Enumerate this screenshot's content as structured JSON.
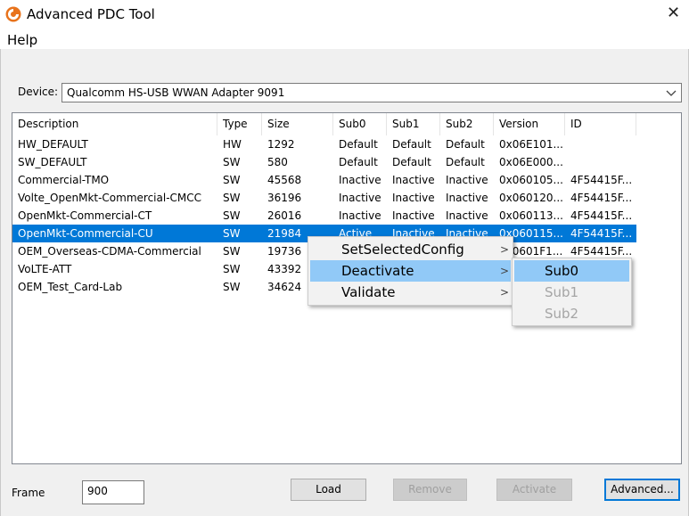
{
  "window": {
    "title": "Advanced PDC Tool",
    "close_glyph": "✕"
  },
  "menu": {
    "help": "Help"
  },
  "device": {
    "label": "Device:",
    "value": "Qualcomm HS-USB WWAN Adapter 9091"
  },
  "table": {
    "columns": [
      "Description",
      "Type",
      "Size",
      "Sub0",
      "Sub1",
      "Sub2",
      "Version",
      "ID"
    ],
    "rows": [
      [
        "HW_DEFAULT",
        "HW",
        "1292",
        "Default",
        "Default",
        "Default",
        "0x06E101...",
        ""
      ],
      [
        "SW_DEFAULT",
        "SW",
        "580",
        "Default",
        "Default",
        "Default",
        "0x06E000...",
        ""
      ],
      [
        "Commercial-TMO",
        "SW",
        "45568",
        "Inactive",
        "Inactive",
        "Inactive",
        "0x060105...",
        "4F54415F..."
      ],
      [
        "Volte_OpenMkt-Commercial-CMCC",
        "SW",
        "36196",
        "Inactive",
        "Inactive",
        "Inactive",
        "0x060120...",
        "4F54415F..."
      ],
      [
        "OpenMkt-Commercial-CT",
        "SW",
        "26016",
        "Inactive",
        "Inactive",
        "Inactive",
        "0x060113...",
        "4F54415F..."
      ],
      [
        "OpenMkt-Commercial-CU",
        "SW",
        "21984",
        "Active",
        "Inactive",
        "Inactive",
        "0x060115...",
        "4F54415F..."
      ],
      [
        "OEM_Overseas-CDMA-Commercial",
        "SW",
        "19736",
        "",
        "",
        "",
        "0x0601F1...",
        "4F54415F..."
      ],
      [
        "VoLTE-ATT",
        "SW",
        "43392",
        "",
        "",
        "",
        "",
        ""
      ],
      [
        "OEM_Test_Card-Lab",
        "SW",
        "34624",
        "",
        "",
        "",
        "",
        ""
      ]
    ],
    "selected_row": 5
  },
  "context_menu": {
    "items": [
      {
        "label": "SetSelectedConfig",
        "arrow": ">"
      },
      {
        "label": "Deactivate",
        "arrow": ">"
      },
      {
        "label": "Validate",
        "arrow": ">"
      }
    ],
    "hover_index": 1
  },
  "submenu": {
    "items": [
      {
        "label": "Sub0",
        "enabled": true
      },
      {
        "label": "Sub1",
        "enabled": false
      },
      {
        "label": "Sub2",
        "enabled": false
      }
    ]
  },
  "frame": {
    "label": "Frame",
    "value": "900"
  },
  "buttons": {
    "load": "Load",
    "remove": "Remove",
    "activate": "Activate",
    "advanced": "Advanced..."
  },
  "colors": {
    "selection": "#0078d7",
    "menu_hover": "#91c9f7",
    "app_icon": "#e8731c"
  },
  "icons": {
    "app": "app-logo-icon",
    "close": "close-icon",
    "dropdown": "chevron-down-icon",
    "submenu": "chevron-right-icon"
  }
}
